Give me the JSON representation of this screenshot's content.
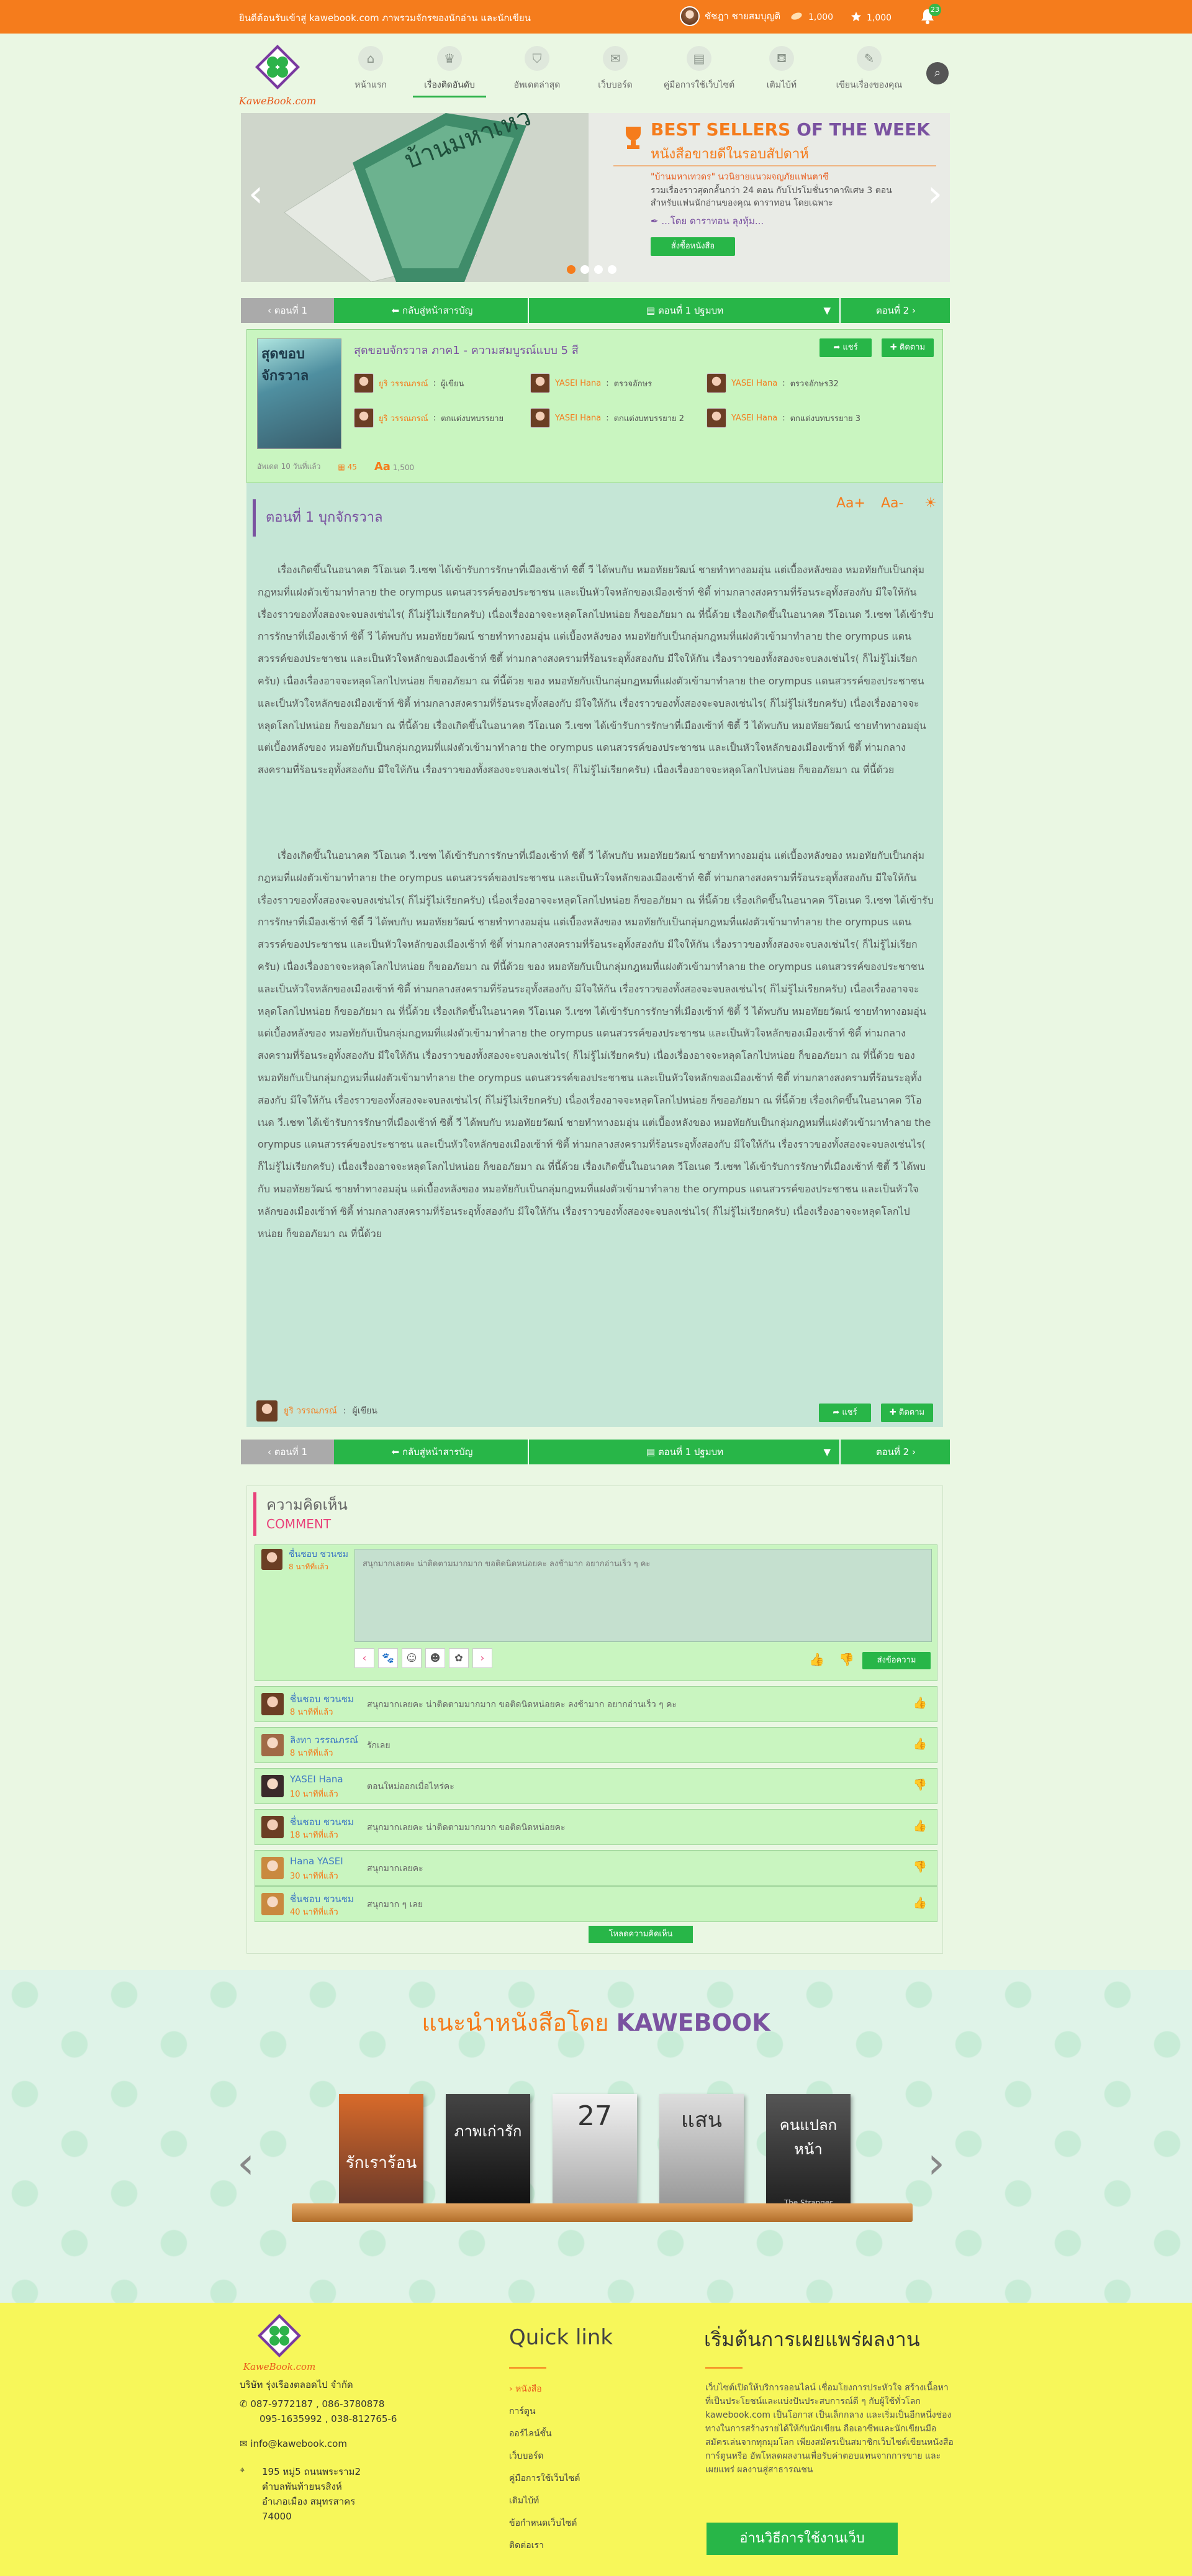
{
  "topbar": {
    "welcome": "ยินดีต้อนรับเข้าสู่ kawebook.com ภาพรวมจักรของนักอ่าน และนักเขียน",
    "user_name": "ชัชฎา ชายสมบุญติ",
    "coins": "1,000",
    "points": "1,000",
    "notifications": "23"
  },
  "nav": [
    {
      "label": "หน้าแรก",
      "icon": "home-icon"
    },
    {
      "label": "เรื่องติดอันดับ",
      "icon": "trophy-icon"
    },
    {
      "label": "อัพเดตล่าสุด",
      "icon": "shield-icon"
    },
    {
      "label": "เว็บบอร์ด",
      "icon": "chat-icon"
    },
    {
      "label": "คู่มือการใช้เว็บไซต์",
      "icon": "book-icon"
    },
    {
      "label": "เติมไบ้ท์",
      "icon": "tag-icon"
    },
    {
      "label": "เขียนเรื่องของคุณ",
      "icon": "pen-icon"
    }
  ],
  "banner": {
    "headline_1": "BEST SELLERS",
    "headline_2": "OF THE WEEK",
    "subheadline": "หนังสือขายดีในรอบสัปดาห์",
    "book_cover_title": "บ้านมหาเหวี",
    "description_1": "\"บ้านมหาเทวดร\" นวนิยายแนวผจญภัยแฟนตาซี",
    "description_2": "รวมเรื่องราวสุดกลั้นกว่า 24 ตอน กับโปรโมชั่นราคาพิเศษ 3 ตอน",
    "description_3": "สำหรับแฟนนักอ่านของคุณ ดาราทอน โดยเฉพาะ",
    "author": "...โดย ดาราทอน ลุงทุ้ม...",
    "buy_button": "สั่งซื้อหนังสือ"
  },
  "chapter_nav": {
    "prev": "ตอนที่ 1",
    "toc": "กลับสู่หน้าสารบัญ",
    "current": "ตอนที่ 1 ปฐมบท",
    "next": "ตอนที่ 2"
  },
  "book_info": {
    "title": "สุดขอบจักรวาล ภาค1 - ความสมบูรณ์แบบ 5 สี",
    "cover_title": "สุดขอบจักรวาล",
    "share_button": "แชร์",
    "follow_button": "ติดตาม",
    "credits": [
      {
        "name": "ยูริ วรรณภรณ์",
        "role": "ผู้เขียน"
      },
      {
        "name": "YASEI Hana",
        "role": "ตรวจอักษร"
      },
      {
        "name": "YASEI Hana",
        "role": "ตรวจอักษร32"
      },
      {
        "name": "ยูริ วรรณภรณ์",
        "role": "ตกแต่งบทบรรยาย"
      },
      {
        "name": "YASEI Hana",
        "role": "ตกแต่งบทบรรยาย 2"
      },
      {
        "name": "YASEI Hana",
        "role": "ตกแต่งบทบรรยาย 3"
      }
    ],
    "updated": "อัพเดต 10 วันที่แล้ว",
    "comment_count": "45",
    "view_count": "1,500"
  },
  "reading": {
    "font_larger": "Aa+",
    "font_smaller": "Aa-",
    "chapter_title": "ตอนที่ 1 บุกจักรวาล",
    "paragraph_1": "เรื่องเกิดขึ้นในอนาคต วีโอเนด วี.เซฑ ได้เข้ารับการรักษาที่เมืองเซ้าท์ ซิตี้ วี ได้พบกับ หมอทัยยวัฒน์ ชายทำทางอมอุ่น แต่เบื้องหลังของ หมอทัยกับเป็นกลุ่มกฎหมที่แฝงตัวเข้ามาทำลาย the orympus แดนสวรรค์ของประชาชน และเป็นหัวใจหลักของเมืองเซ้าท์ ซิตี้ ท่ามกลางสงครามที่ร้อนระอุทั้งสองกับ มีใจให้กัน เรื่องราวของทั้งสองจะจบลงเช่นไร( ก็ไม่รู้ไม่เรียกครับ) เนื่องเรื่องอาจจะหลุดโลกไปหน่อย ก็ขออภัยมา ณ ที่นี้ด้วย เรื่องเกิดขึ้นในอนาคต วีโอเนด วี.เซฑ ได้เข้ารับการรักษาที่เมืองเซ้าท์ ซิตี้ วี ได้พบกับ หมอทัยยวัฒน์ ชายทำทางอมอุ่น แต่เบื้องหลังของ หมอทัยกับเป็นกลุ่มกฎหมที่แฝงตัวเข้ามาทำลาย the orympus แดนสวรรค์ของประชาชน และเป็นหัวใจหลักของเมืองเซ้าท์ ซิตี้ ท่ามกลางสงครามที่ร้อนระอุทั้งสองกับ มีใจให้กัน เรื่องราวของทั้งสองจะจบลงเช่นไร( ก็ไม่รู้ไม่เรียกครับ) เนื่องเรื่องอาจจะหลุดโลกไปหน่อย ก็ขออภัยมา ณ ที่นี้ด้วย ของ หมอทัยกับเป็นกลุ่มกฎหมที่แฝงตัวเข้ามาทำลาย the orympus แดนสวรรค์ของประชาชน และเป็นหัวใจหลักของเมืองเซ้าท์ ซิตี้ ท่ามกลางสงครามที่ร้อนระอุทั้งสองกับ มีใจให้กัน เรื่องราวของทั้งสองจะจบลงเช่นไร( ก็ไม่รู้ไม่เรียกครับ) เนื่องเรื่องอาจจะหลุดโลกไปหน่อย ก็ขออภัยมา ณ ที่นี้ด้วย เรื่องเกิดขึ้นในอนาคต วีโอเนด วี.เซฑ ได้เข้ารับการรักษาที่เมืองเซ้าท์ ซิตี้ วี ได้พบกับ หมอทัยยวัฒน์ ชายทำทางอมอุ่น แต่เบื้องหลังของ หมอทัยกับเป็นกลุ่มกฎหมที่แฝงตัวเข้ามาทำลาย the orympus แดนสวรรค์ของประชาชน และเป็นหัวใจหลักของเมืองเซ้าท์ ซิตี้ ท่ามกลางสงครามที่ร้อนระอุทั้งสองกับ มีใจให้กัน เรื่องราวของทั้งสองจะจบลงเช่นไร( ก็ไม่รู้ไม่เรียกครับ) เนื่องเรื่องอาจจะหลุดโลกไปหน่อย ก็ขออภัยมา ณ ที่นี้ด้วย",
    "paragraph_2": "เรื่องเกิดขึ้นในอนาคต วีโอเนด วี.เซฑ ได้เข้ารับการรักษาที่เมืองเซ้าท์ ซิตี้ วี ได้พบกับ หมอทัยยวัฒน์ ชายทำทางอมอุ่น แต่เบื้องหลังของ หมอทัยกับเป็นกลุ่มกฎหมที่แฝงตัวเข้ามาทำลาย the orympus แดนสวรรค์ของประชาชน และเป็นหัวใจหลักของเมืองเซ้าท์ ซิตี้ ท่ามกลางสงครามที่ร้อนระอุทั้งสองกับ มีใจให้กัน เรื่องราวของทั้งสองจะจบลงเช่นไร( ก็ไม่รู้ไม่เรียกครับ) เนื่องเรื่องอาจจะหลุดโลกไปหน่อย ก็ขออภัยมา ณ ที่นี้ด้วย เรื่องเกิดขึ้นในอนาคต วีโอเนด วี.เซฑ ได้เข้ารับการรักษาที่เมืองเซ้าท์ ซิตี้ วี ได้พบกับ หมอทัยยวัฒน์ ชายทำทางอมอุ่น แต่เบื้องหลังของ หมอทัยกับเป็นกลุ่มกฎหมที่แฝงตัวเข้ามาทำลาย the orympus แดนสวรรค์ของประชาชน และเป็นหัวใจหลักของเมืองเซ้าท์ ซิตี้ ท่ามกลางสงครามที่ร้อนระอุทั้งสองกับ มีใจให้กัน เรื่องราวของทั้งสองจะจบลงเช่นไร( ก็ไม่รู้ไม่เรียกครับ) เนื่องเรื่องอาจจะหลุดโลกไปหน่อย ก็ขออภัยมา ณ ที่นี้ด้วย ของ หมอทัยกับเป็นกลุ่มกฎหมที่แฝงตัวเข้ามาทำลาย the orympus แดนสวรรค์ของประชาชน และเป็นหัวใจหลักของเมืองเซ้าท์ ซิตี้ ท่ามกลางสงครามที่ร้อนระอุทั้งสองกับ มีใจให้กัน เรื่องราวของทั้งสองจะจบลงเช่นไร( ก็ไม่รู้ไม่เรียกครับ) เนื่องเรื่องอาจจะหลุดโลกไปหน่อย ก็ขออภัยมา ณ ที่นี้ด้วย เรื่องเกิดขึ้นในอนาคต วีโอเนด วี.เซฑ ได้เข้ารับการรักษาที่เมืองเซ้าท์ ซิตี้ วี ได้พบกับ หมอทัยยวัฒน์ ชายทำทางอมอุ่น แต่เบื้องหลังของ หมอทัยกับเป็นกลุ่มกฎหมที่แฝงตัวเข้ามาทำลาย the orympus แดนสวรรค์ของประชาชน และเป็นหัวใจหลักของเมืองเซ้าท์ ซิตี้ ท่ามกลางสงครามที่ร้อนระอุทั้งสองกับ มีใจให้กัน เรื่องราวของทั้งสองจะจบลงเช่นไร( ก็ไม่รู้ไม่เรียกครับ) เนื่องเรื่องอาจจะหลุดโลกไปหน่อย ก็ขออภัยมา ณ ที่นี้ด้วย ของ หมอทัยกับเป็นกลุ่มกฎหมที่แฝงตัวเข้ามาทำลาย the orympus แดนสวรรค์ของประชาชน และเป็นหัวใจหลักของเมืองเซ้าท์ ซิตี้ ท่ามกลางสงครามที่ร้อนระอุทั้งสองกับ มีใจให้กัน เรื่องราวของทั้งสองจะจบลงเช่นไร( ก็ไม่รู้ไม่เรียกครับ) เนื่องเรื่องอาจจะหลุดโลกไปหน่อย ก็ขออภัยมา ณ ที่นี้ด้วย เรื่องเกิดขึ้นในอนาคต วีโอเนด วี.เซฑ ได้เข้ารับการรักษาที่เมืองเซ้าท์ ซิตี้ วี ได้พบกับ หมอทัยยวัฒน์ ชายทำทางอมอุ่น แต่เบื้องหลังของ หมอทัยกับเป็นกลุ่มกฎหมที่แฝงตัวเข้ามาทำลาย the orympus แดนสวรรค์ของประชาชน และเป็นหัวใจหลักของเมืองเซ้าท์ ซิตี้ ท่ามกลางสงครามที่ร้อนระอุทั้งสองกับ มีใจให้กัน เรื่องราวของทั้งสองจะจบลงเช่นไร( ก็ไม่รู้ไม่เรียกครับ) เนื่องเรื่องอาจจะหลุดโลกไปหน่อย ก็ขออภัยมา ณ ที่นี้ด้วย เรื่องเกิดขึ้นในอนาคต วีโอเนด วี.เซฑ ได้เข้ารับการรักษาที่เมืองเซ้าท์ ซิตี้ วี ได้พบกับ หมอทัยยวัฒน์ ชายทำทางอมอุ่น แต่เบื้องหลังของ หมอทัยกับเป็นกลุ่มกฎหมที่แฝงตัวเข้ามาทำลาย the orympus แดนสวรรค์ของประชาชน และเป็นหัวใจหลักของเมืองเซ้าท์ ซิตี้ ท่ามกลางสงครามที่ร้อนระอุทั้งสองกับ มีใจให้กัน เรื่องราวของทั้งสองจะจบลงเช่นไร( ก็ไม่รู้ไม่เรียกครับ) เนื่องเรื่องอาจจะหลุดโลกไปหน่อย ก็ขออภัยมา ณ ที่นี้ด้วย",
    "author_name": "ยูริ วรรณภรณ์",
    "author_role": "ผู้เขียน"
  },
  "comments": {
    "title": "ความคิดเห็น",
    "subtitle": "COMMENT",
    "compose_name": "ชื่นชอบ ชวนชม",
    "compose_time": "8 นาทีที่แล้ว",
    "compose_text": "สนุกมากเลยคะ น่าติดตามมากมาก ขอติดนิดหน่อยคะ ลงช้ามาก อยากอ่านเร็ว ๆ คะ",
    "submit_button": "ส่งข้อความ",
    "items": [
      {
        "name": "ชื่นชอบ ชวนชม",
        "time": "8 นาทีที่แล้ว",
        "text": "สนุกมากเลยคะ น่าติดตามมากมาก ขอติดนิดหน่อยคะ ลงช้ามาก อยากอ่านเร็ว ๆ คะ"
      },
      {
        "name": "ลิงทา วรรณภรณ์",
        "time": "8 นาทีที่แล้ว",
        "text": "รักเลย"
      },
      {
        "name": "YASEI Hana",
        "time": "10 นาทีที่แล้ว",
        "text": "ตอนใหม่ออกเมื่อไหร่คะ"
      },
      {
        "name": "ชื่นชอบ ชวนชม",
        "time": "18 นาทีที่แล้ว",
        "text": "สนุกมากเลยคะ น่าติดตามมากมาก ขอติดนิดหน่อยคะ"
      },
      {
        "name": "Hana YASEI",
        "time": "30 นาทีที่แล้ว",
        "text": "สนุกมากเลยคะ"
      },
      {
        "name": "ชื่นชอบ ชวนชม",
        "time": "40 นาทีที่แล้ว",
        "text": "สนุกมาก ๆ เลย"
      }
    ],
    "load_more": "โหลดความคิดเห็น"
  },
  "recommend": {
    "title_prefix": "แนะนำหนังสือโดย",
    "title_brand": "KAWEBOOK",
    "books": [
      {
        "title": "รักเราร้อน"
      },
      {
        "title": "ภาพเก่ารัก"
      },
      {
        "title": "27"
      },
      {
        "title": "แสน"
      },
      {
        "title": "คนแปลกหน้า",
        "subtitle": "The Stranger"
      }
    ]
  },
  "footer": {
    "logo_text": "KaweBook.com",
    "company": "บริษัท รุ่งเรืองตลอดไป จำกัด",
    "phone_1": "087-9772187 , 086-3780878",
    "phone_2": "095-1635992 , 038-812765-6",
    "email": "info@kawebook.com",
    "address_1": "195 หมู่5 ถนนพระราม2",
    "address_2": "ตำบลพันท้ายนรสิงห์",
    "address_3": "อำเภอเมือง สมุทรสาคร",
    "address_4": "74000",
    "quicklink_title": "Quick link",
    "quicklinks": [
      "หนังสือ",
      "การ์ตูน",
      "ออร์ไลน์ชั้น",
      "เว็บบอร์ด",
      "คู่มือการใช้เว็บไซต์",
      "เติมไบ้ท์",
      "ข้อกำหนดเว็บไซต์",
      "ติดต่อเรา"
    ],
    "publish_title": "เริ่มต้นการเผยแพร่ผลงาน",
    "publish_text": "เว็บไซต์เปิดให้บริการออนไลน์ เชื่อมโยงการประหัวใจ สร้างเนื้อหาที่เป็นประโยชน์และแบ่งปันประสบการณ์ดี ๆ กับผู้ใช้ทั่วโลก kawebook.com เป็นโอกาส เป็นเล็กกลาง และเริ่มเป็นอีกหนึ่งช่องทางในการสร้างรายได้ให้กับนักเขียน ถือเอาซีพและนักเขียนมือสมัครเล่นจากทุกมุมโลก เพียงสมัครเป็นสมาชิกเว็บไซต์เขียนหนังสือ การ์ตูนหรือ อัพโหลดผลงานเพื่อรับค่าตอบแทนจากการขาย และเผยแพร่ ผลงานสู่สาธารณชน",
    "publish_button": "อ่านวิธีการใช้งานเว็บ"
  }
}
